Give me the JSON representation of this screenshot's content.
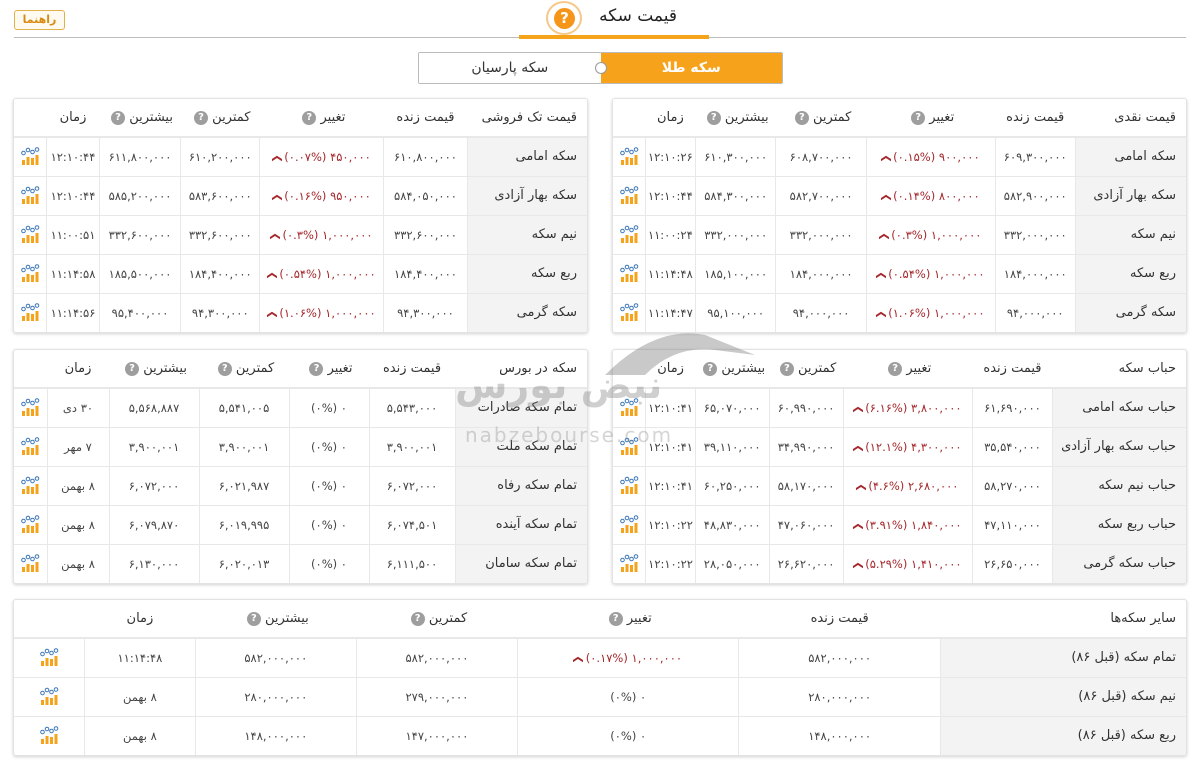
{
  "header": {
    "help_button": "راهنما",
    "title": "قیمت سکه",
    "help_icon": "question-icon"
  },
  "toggle": {
    "active": "سکه طلا",
    "inactive": "سکه پارسیان"
  },
  "watermark": {
    "text": "nabzebourse.com",
    "logo_text": "نبض بورس"
  },
  "columns": {
    "live": "قیمت زنده",
    "change": "تغییر",
    "min": "کمترین",
    "max": "بیشترین",
    "time": "زمان"
  },
  "tables": {
    "cash": {
      "title": "قیمت نقدی",
      "rows": [
        {
          "name": "سکه امامی",
          "live": "۶۰۹,۳۰۰,۰۰۰",
          "change": "۹۰۰,۰۰۰ (۰.۱۵%)",
          "dir": "down",
          "min": "۶۰۸,۷۰۰,۰۰۰",
          "max": "۶۱۰,۳۰۰,۰۰۰",
          "time": "۱۲:۱۰:۲۶"
        },
        {
          "name": "سکه بهار آزادی",
          "live": "۵۸۲,۹۰۰,۰۰۰",
          "change": "۸۰۰,۰۰۰ (۰.۱۴%)",
          "dir": "down",
          "min": "۵۸۲,۷۰۰,۰۰۰",
          "max": "۵۸۴,۳۰۰,۰۰۰",
          "time": "۱۲:۱۰:۴۴"
        },
        {
          "name": "نیم سکه",
          "live": "۳۳۲,۰۰۰,۰۰۰",
          "change": "۱,۰۰۰,۰۰۰ (۰.۳%)",
          "dir": "down",
          "min": "۳۳۲,۰۰۰,۰۰۰",
          "max": "۳۳۲,۰۰۰,۰۰۰",
          "time": "۱۱:۰۰:۲۴"
        },
        {
          "name": "ربع سکه",
          "live": "۱۸۴,۰۰۰,۰۰۰",
          "change": "۱,۰۰۰,۰۰۰ (۰.۵۴%)",
          "dir": "down",
          "min": "۱۸۴,۰۰۰,۰۰۰",
          "max": "۱۸۵,۱۰۰,۰۰۰",
          "time": "۱۱:۱۴:۴۸"
        },
        {
          "name": "سکه گرمی",
          "live": "۹۴,۰۰۰,۰۰۰",
          "change": "۱,۰۰۰,۰۰۰ (۱.۰۶%)",
          "dir": "down",
          "min": "۹۴,۰۰۰,۰۰۰",
          "max": "۹۵,۱۰۰,۰۰۰",
          "time": "۱۱:۱۴:۴۷"
        }
      ]
    },
    "retail": {
      "title": "قیمت تک فروشی",
      "rows": [
        {
          "name": "سکه امامی",
          "live": "۶۱۰,۸۰۰,۰۰۰",
          "change": "۴۵۰,۰۰۰ (۰.۰۷%)",
          "dir": "down",
          "min": "۶۱۰,۲۰۰,۰۰۰",
          "max": "۶۱۱,۸۰۰,۰۰۰",
          "time": "۱۲:۱۰:۴۴"
        },
        {
          "name": "سکه بهار آزادی",
          "live": "۵۸۴,۰۵۰,۰۰۰",
          "change": "۹۵۰,۰۰۰ (۰.۱۶%)",
          "dir": "down",
          "min": "۵۸۳,۶۰۰,۰۰۰",
          "max": "۵۸۵,۲۰۰,۰۰۰",
          "time": "۱۲:۱۰:۴۴"
        },
        {
          "name": "نیم سکه",
          "live": "۳۳۲,۶۰۰,۰۰۰",
          "change": "۱,۰۰۰,۰۰۰ (۰.۳%)",
          "dir": "down",
          "min": "۳۳۲,۶۰۰,۰۰۰",
          "max": "۳۳۲,۶۰۰,۰۰۰",
          "time": "۱۱:۰۰:۵۱"
        },
        {
          "name": "ربع سکه",
          "live": "۱۸۴,۴۰۰,۰۰۰",
          "change": "۱,۰۰۰,۰۰۰ (۰.۵۴%)",
          "dir": "down",
          "min": "۱۸۴,۴۰۰,۰۰۰",
          "max": "۱۸۵,۵۰۰,۰۰۰",
          "time": "۱۱:۱۴:۵۸"
        },
        {
          "name": "سکه گرمی",
          "live": "۹۴,۳۰۰,۰۰۰",
          "change": "۱,۰۰۰,۰۰۰ (۱.۰۶%)",
          "dir": "down",
          "min": "۹۴,۳۰۰,۰۰۰",
          "max": "۹۵,۴۰۰,۰۰۰",
          "time": "۱۱:۱۴:۵۶"
        }
      ]
    },
    "bubble": {
      "title": "حباب سکه",
      "rows": [
        {
          "name": "حباب سکه امامی",
          "live": "۶۱,۶۹۰,۰۰۰",
          "change": "۳,۸۰۰,۰۰۰ (۶.۱۶%)",
          "dir": "down",
          "min": "۶۰,۹۹۰,۰۰۰",
          "max": "۶۵,۰۷۰,۰۰۰",
          "time": "۱۲:۱۰:۴۱"
        },
        {
          "name": "حباب سکه بهار آزادی",
          "live": "۳۵,۵۴۰,۰۰۰",
          "change": "۴,۳۰۰,۰۰۰ (۱۲.۱%)",
          "dir": "down",
          "min": "۳۴,۹۹۰,۰۰۰",
          "max": "۳۹,۱۱۰,۰۰۰",
          "time": "۱۲:۱۰:۴۱"
        },
        {
          "name": "حباب نیم سکه",
          "live": "۵۸,۲۷۰,۰۰۰",
          "change": "۲,۶۸۰,۰۰۰ (۴.۶%)",
          "dir": "down",
          "min": "۵۸,۱۷۰,۰۰۰",
          "max": "۶۰,۲۵۰,۰۰۰",
          "time": "۱۲:۱۰:۴۱"
        },
        {
          "name": "حباب ربع سکه",
          "live": "۴۷,۱۱۰,۰۰۰",
          "change": "۱,۸۴۰,۰۰۰ (۳.۹۱%)",
          "dir": "down",
          "min": "۴۷,۰۶۰,۰۰۰",
          "max": "۴۸,۸۳۰,۰۰۰",
          "time": "۱۲:۱۰:۲۲"
        },
        {
          "name": "حباب سکه گرمی",
          "live": "۲۶,۶۵۰,۰۰۰",
          "change": "۱,۴۱۰,۰۰۰ (۵.۲۹%)",
          "dir": "down",
          "min": "۲۶,۶۲۰,۰۰۰",
          "max": "۲۸,۰۵۰,۰۰۰",
          "time": "۱۲:۱۰:۲۲"
        }
      ]
    },
    "bourse": {
      "title": "سکه در بورس",
      "rows": [
        {
          "name": "تمام سکه صادرات",
          "live": "۵,۵۴۳,۰۰۰",
          "change": "۰ (۰%)",
          "dir": "flat",
          "min": "۵,۵۴۱,۰۰۵",
          "max": "۵,۵۶۸,۸۸۷",
          "time": "۳۰ دی"
        },
        {
          "name": "تمام سکه ملت",
          "live": "۳,۹۰۰,۰۰۱",
          "change": "۰ (۰%)",
          "dir": "flat",
          "min": "۳,۹۰۰,۰۰۱",
          "max": "۳,۹۰۰,۰۰۱",
          "time": "۷ مهر"
        },
        {
          "name": "تمام سکه رفاه",
          "live": "۶,۰۷۲,۰۰۰",
          "change": "۰ (۰%)",
          "dir": "flat",
          "min": "۶,۰۲۱,۹۸۷",
          "max": "۶,۰۷۲,۰۰۰",
          "time": "۸ بهمن"
        },
        {
          "name": "تمام سکه آینده",
          "live": "۶,۰۷۴,۵۰۱",
          "change": "۰ (۰%)",
          "dir": "flat",
          "min": "۶,۰۱۹,۹۹۵",
          "max": "۶,۰۷۹,۸۷۰",
          "time": "۸ بهمن"
        },
        {
          "name": "تمام سکه سامان",
          "live": "۶,۱۱۱,۵۰۰",
          "change": "۰ (۰%)",
          "dir": "flat",
          "min": "۶,۰۲۰,۰۱۳",
          "max": "۶,۱۳۰,۰۰۰",
          "time": "۸ بهمن"
        }
      ]
    },
    "other": {
      "title": "سایر سکه‌ها",
      "rows": [
        {
          "name": "تمام سکه (قبل ۸۶)",
          "live": "۵۸۲,۰۰۰,۰۰۰",
          "change": "۱,۰۰۰,۰۰۰ (۰.۱۷%)",
          "dir": "down",
          "min": "۵۸۲,۰۰۰,۰۰۰",
          "max": "۵۸۲,۰۰۰,۰۰۰",
          "time": "۱۱:۱۴:۴۸"
        },
        {
          "name": "نیم سکه (قبل ۸۶)",
          "live": "۲۸۰,۰۰۰,۰۰۰",
          "change": "۰ (۰%)",
          "dir": "flat",
          "min": "۲۷۹,۰۰۰,۰۰۰",
          "max": "۲۸۰,۰۰۰,۰۰۰",
          "time": "۸ بهمن"
        },
        {
          "name": "ربع سکه (قبل ۸۶)",
          "live": "۱۴۸,۰۰۰,۰۰۰",
          "change": "۰ (۰%)",
          "dir": "flat",
          "min": "۱۴۷,۰۰۰,۰۰۰",
          "max": "۱۴۸,۰۰۰,۰۰۰",
          "time": "۸ بهمن"
        }
      ]
    }
  },
  "colors": {
    "accent": "#f7a21b",
    "down": "#a5282c"
  }
}
